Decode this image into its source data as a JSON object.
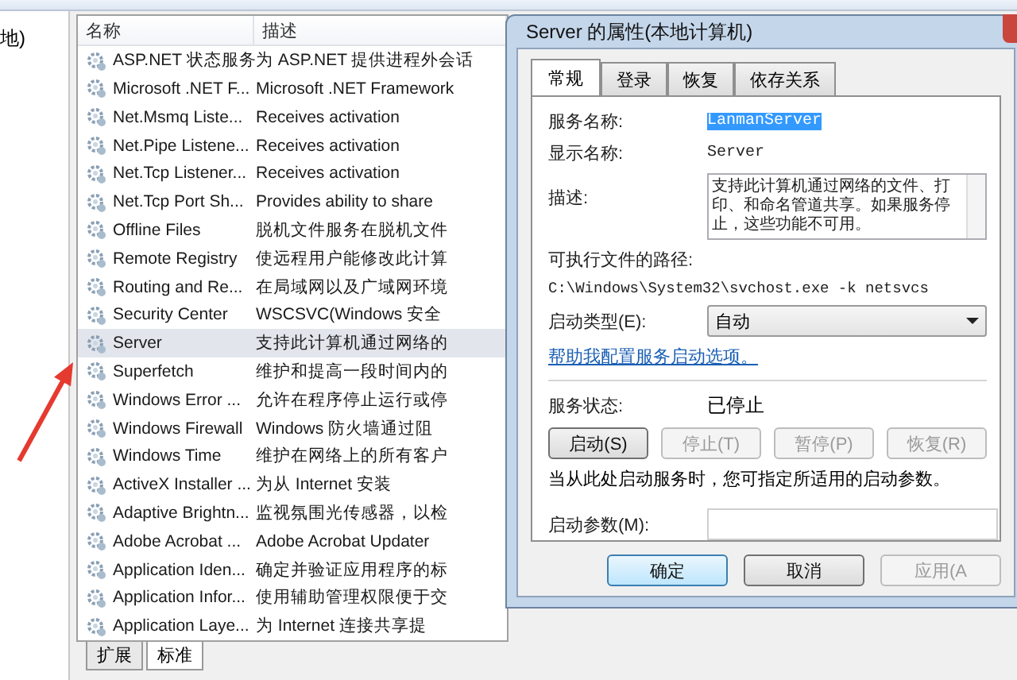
{
  "tree": {
    "fragment": "地)"
  },
  "services": {
    "columns": [
      "名称",
      "描述"
    ],
    "rows": [
      {
        "name": "ASP.NET 状态服务",
        "desc": "为 ASP.NET 提供进程外会话",
        "selected": false
      },
      {
        "name": "Microsoft .NET F...",
        "desc": "Microsoft .NET Framework",
        "selected": false
      },
      {
        "name": "Net.Msmq Liste...",
        "desc": "Receives activation",
        "selected": false
      },
      {
        "name": "Net.Pipe Listene...",
        "desc": "Receives activation",
        "selected": false
      },
      {
        "name": "Net.Tcp Listener...",
        "desc": "Receives activation",
        "selected": false
      },
      {
        "name": "Net.Tcp Port Sh...",
        "desc": "Provides ability to share",
        "selected": false
      },
      {
        "name": "Offline Files",
        "desc": "脱机文件服务在脱机文件",
        "selected": false
      },
      {
        "name": "Remote Registry",
        "desc": "使远程用户能修改此计算",
        "selected": false
      },
      {
        "name": "Routing and Re...",
        "desc": "在局域网以及广域网环境",
        "selected": false
      },
      {
        "name": "Security Center",
        "desc": "WSCSVC(Windows 安全",
        "selected": false
      },
      {
        "name": "Server",
        "desc": "支持此计算机通过网络的",
        "selected": true
      },
      {
        "name": "Superfetch",
        "desc": "维护和提高一段时间内的",
        "selected": false
      },
      {
        "name": "Windows Error ...",
        "desc": "允许在程序停止运行或停",
        "selected": false
      },
      {
        "name": "Windows Firewall",
        "desc": "Windows 防火墙通过阻",
        "selected": false
      },
      {
        "name": "Windows Time",
        "desc": "维护在网络上的所有客户",
        "selected": false
      },
      {
        "name": "ActiveX Installer ...",
        "desc": "为从 Internet 安装",
        "selected": false
      },
      {
        "name": "Adaptive Brightn...",
        "desc": "监视氛围光传感器，以检",
        "selected": false
      },
      {
        "name": "Adobe Acrobat ...",
        "desc": "Adobe Acrobat Updater",
        "selected": false
      },
      {
        "name": "Application Iden...",
        "desc": "确定并验证应用程序的标",
        "selected": false
      },
      {
        "name": "Application Infor...",
        "desc": "使用辅助管理权限便于交",
        "selected": false
      },
      {
        "name": "Application Laye...",
        "desc": "为 Internet 连接共享提",
        "selected": false
      }
    ],
    "view_tabs": [
      {
        "label": "扩展",
        "selected": false
      },
      {
        "label": "标准",
        "selected": true
      }
    ]
  },
  "dialog": {
    "title": "Server 的属性(本地计算机)",
    "tabs": [
      {
        "label": "常规",
        "selected": true
      },
      {
        "label": "登录",
        "selected": false
      },
      {
        "label": "恢复",
        "selected": false
      },
      {
        "label": "依存关系",
        "selected": false
      }
    ],
    "service_name": {
      "label": "服务名称:",
      "value": "LanmanServer",
      "highlighted": true
    },
    "display_name": {
      "label": "显示名称:",
      "value": "Server"
    },
    "description": {
      "label": "描述:",
      "value": "支持此计算机通过网络的文件、打印、和命名管道共享。如果服务停止，这些功能不可用。"
    },
    "path": {
      "label": "可执行文件的路径:",
      "value": "C:\\Windows\\System32\\svchost.exe -k netsvcs"
    },
    "startup_type": {
      "label": "启动类型(E):",
      "value": "自动"
    },
    "help_link": "帮助我配置服务启动选项。",
    "status": {
      "label": "服务状态:",
      "value": "已停止"
    },
    "control_buttons": [
      {
        "label": "启动(S)",
        "disabled": false
      },
      {
        "label": "停止(T)",
        "disabled": true
      },
      {
        "label": "暂停(P)",
        "disabled": true
      },
      {
        "label": "恢复(R)",
        "disabled": true
      }
    ],
    "hint": "当从此处启动服务时，您可指定所适用的启动参数。",
    "params": {
      "label": "启动参数(M):"
    },
    "buttons": [
      {
        "label": "确定",
        "default": true,
        "disabled": false
      },
      {
        "label": "取消",
        "default": false,
        "disabled": false
      },
      {
        "label": "应用(A",
        "default": false,
        "disabled": true
      }
    ]
  }
}
